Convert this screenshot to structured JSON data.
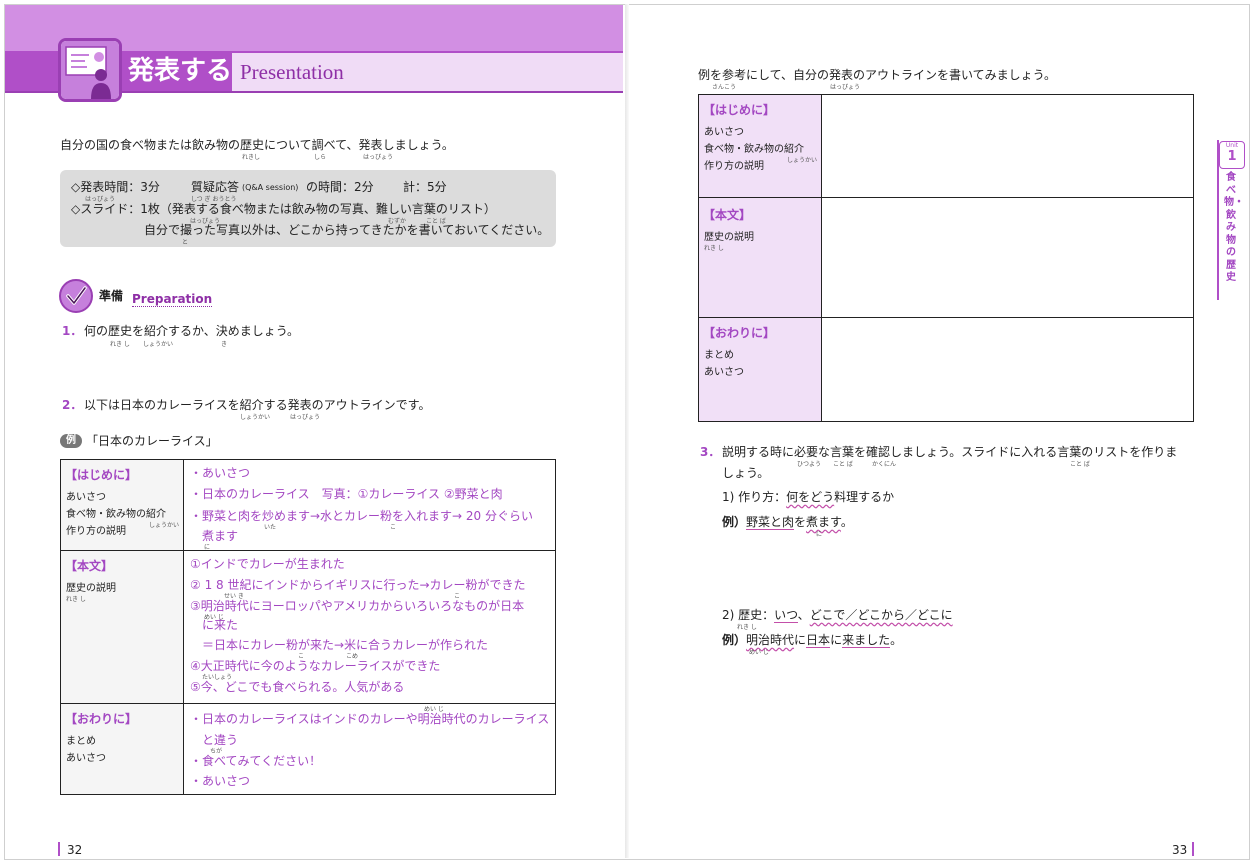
{
  "header": {
    "title_jp": "発表する",
    "title_en": "Presentation"
  },
  "left": {
    "intro": "自分の国の食べ物または飲み物の歴史について調べて、発表しましょう。",
    "intro_ruby": [
      "れきし",
      "しら",
      "はっぴょう"
    ],
    "info": {
      "line1a": "◇発表時間：3分",
      "line1b": "質疑応答",
      "line1c": "(Q&A session)",
      "line1d": "の時間：2分",
      "line1e": "計：5分",
      "line2": "◇スライド：1枚（発表する食べ物または飲み物の写真、難しい言葉のリスト）",
      "line3": "自分で撮った写真以外は、どこから持ってきたかを書いておいてください。",
      "ruby1": "はっぴょう",
      "ruby1b": "しつ ぎ おうとう",
      "ruby2": "はっぴょう",
      "ruby2b": "むずか",
      "ruby2c": "こと ば",
      "ruby3": "と"
    },
    "prep": {
      "label": "準備",
      "label_en": "Preparation"
    },
    "q1": {
      "num": "1．",
      "text": "何の歴史を紹介するか、決めましょう。",
      "ruby_a": "れき し",
      "ruby_b": "しょうかい",
      "ruby_c": "き"
    },
    "q2": {
      "num": "2．",
      "text": "以下は日本のカレーライスを紹介する発表のアウトラインです。",
      "ruby_a": "しょうかい",
      "ruby_b": "はっぴょう"
    },
    "example": {
      "badge": "例",
      "title": "「日本のカレーライス」"
    },
    "table": {
      "rows": [
        {
          "head": "【はじめに】",
          "subs": [
            "あいさつ",
            "食べ物・飲み物の紹介",
            "作り方の説明"
          ],
          "sub_ruby": "しょうかい",
          "content": [
            "・あいさつ",
            "・日本のカレーライス　写真：①カレーライス ②野菜と肉",
            "・野菜と肉を炒めます→水とカレー粉を入れます→ 20 分ぐらい",
            "　煮ます"
          ],
          "ruby_a": "いた",
          "ruby_b": "こ",
          "ruby_c": "に"
        },
        {
          "head": "【本文】",
          "subs": [
            "歴史の説明"
          ],
          "sub_ruby": "れき し",
          "content": [
            "①インドでカレーが生まれた",
            "② 1 8 世紀にインドからイギリスに行った→カレー粉ができた",
            "③明治時代にヨーロッパやアメリカからいろいろなものが日本",
            "　に来た",
            "　＝日本にカレー粉が来た→米に合うカレーが作られた",
            "④大正時代に今のようなカレーライスができた",
            "⑤今、どこでも食べられる。人気がある"
          ],
          "ruby_a": "せい き",
          "ruby_b": "こ",
          "ruby_c": "めい じ",
          "ruby_d": "こ",
          "ruby_e": "こめ",
          "ruby_f": "たいしょう"
        },
        {
          "head": "【おわりに】",
          "subs": [
            "まとめ",
            "あいさつ"
          ],
          "content": [
            "・日本のカレーライスはインドのカレーや明治時代のカレーライス",
            "　と違う",
            "・食べてみてください！",
            "・あいさつ"
          ],
          "ruby_a": "めい じ",
          "ruby_b": "ちが"
        }
      ]
    },
    "page_number": "32"
  },
  "right": {
    "intro": "例を参考にして、自分の発表のアウトラインを書いてみましょう。",
    "intro_ruby_a": "さんこう",
    "intro_ruby_b": "はっぴょう",
    "table": {
      "rows": [
        {
          "head": "【はじめに】",
          "subs": [
            "あいさつ",
            "食べ物・飲み物の紹介",
            "作り方の説明"
          ],
          "sub_ruby": "しょうかい"
        },
        {
          "head": "【本文】",
          "subs": [
            "歴史の説明"
          ],
          "sub_ruby": "れき し"
        },
        {
          "head": "【おわりに】",
          "subs": [
            "まとめ",
            "あいさつ"
          ]
        }
      ]
    },
    "q3": {
      "num": "3．",
      "text1": "説明する時に必要な言葉を確認しましょう。スライドに入れる言葉のリストを作りま",
      "text2": "しょう。",
      "ruby_a": "ひつよう",
      "ruby_b": "こと ば",
      "ruby_c": "かくにん",
      "ruby_d": "こと ば"
    },
    "item1": {
      "label": "1) 作り方：",
      "u1": "何をどう",
      "rest": "料理するか",
      "ex_label": "例）",
      "ex_u1": "野菜と肉",
      "ex_mid": "を",
      "ex_u2": "煮ます",
      "ex_end": "。",
      "ex_ruby": "に"
    },
    "item2": {
      "label": "2) 歴史：",
      "label_ruby": "れき し",
      "u1": "いつ",
      "sep1": "、",
      "u2": "どこで／どこから／どこに",
      "ex_label": "例）",
      "ex_u1": "明治時代",
      "ex_mid": "に",
      "ex_u2": "日本",
      "ex_mid2": "に",
      "ex_u3": "来ました",
      "ex_end": "。",
      "ex_ruby": "めい じ"
    },
    "side": {
      "unit_label": "Unit",
      "unit_num": "1",
      "vertical": "食べ物・飲み物の歴史"
    },
    "page_number": "33"
  },
  "colors": {
    "accent": "#b04fc8",
    "accent_light": "#d28fe3",
    "accent_text": "#a347c2",
    "info_bg": "#dcdcdc",
    "cell_bg": "#f1e0f7"
  },
  "icons": {
    "header_icon": "presentation-icon",
    "prep_icon": "check-icon"
  }
}
